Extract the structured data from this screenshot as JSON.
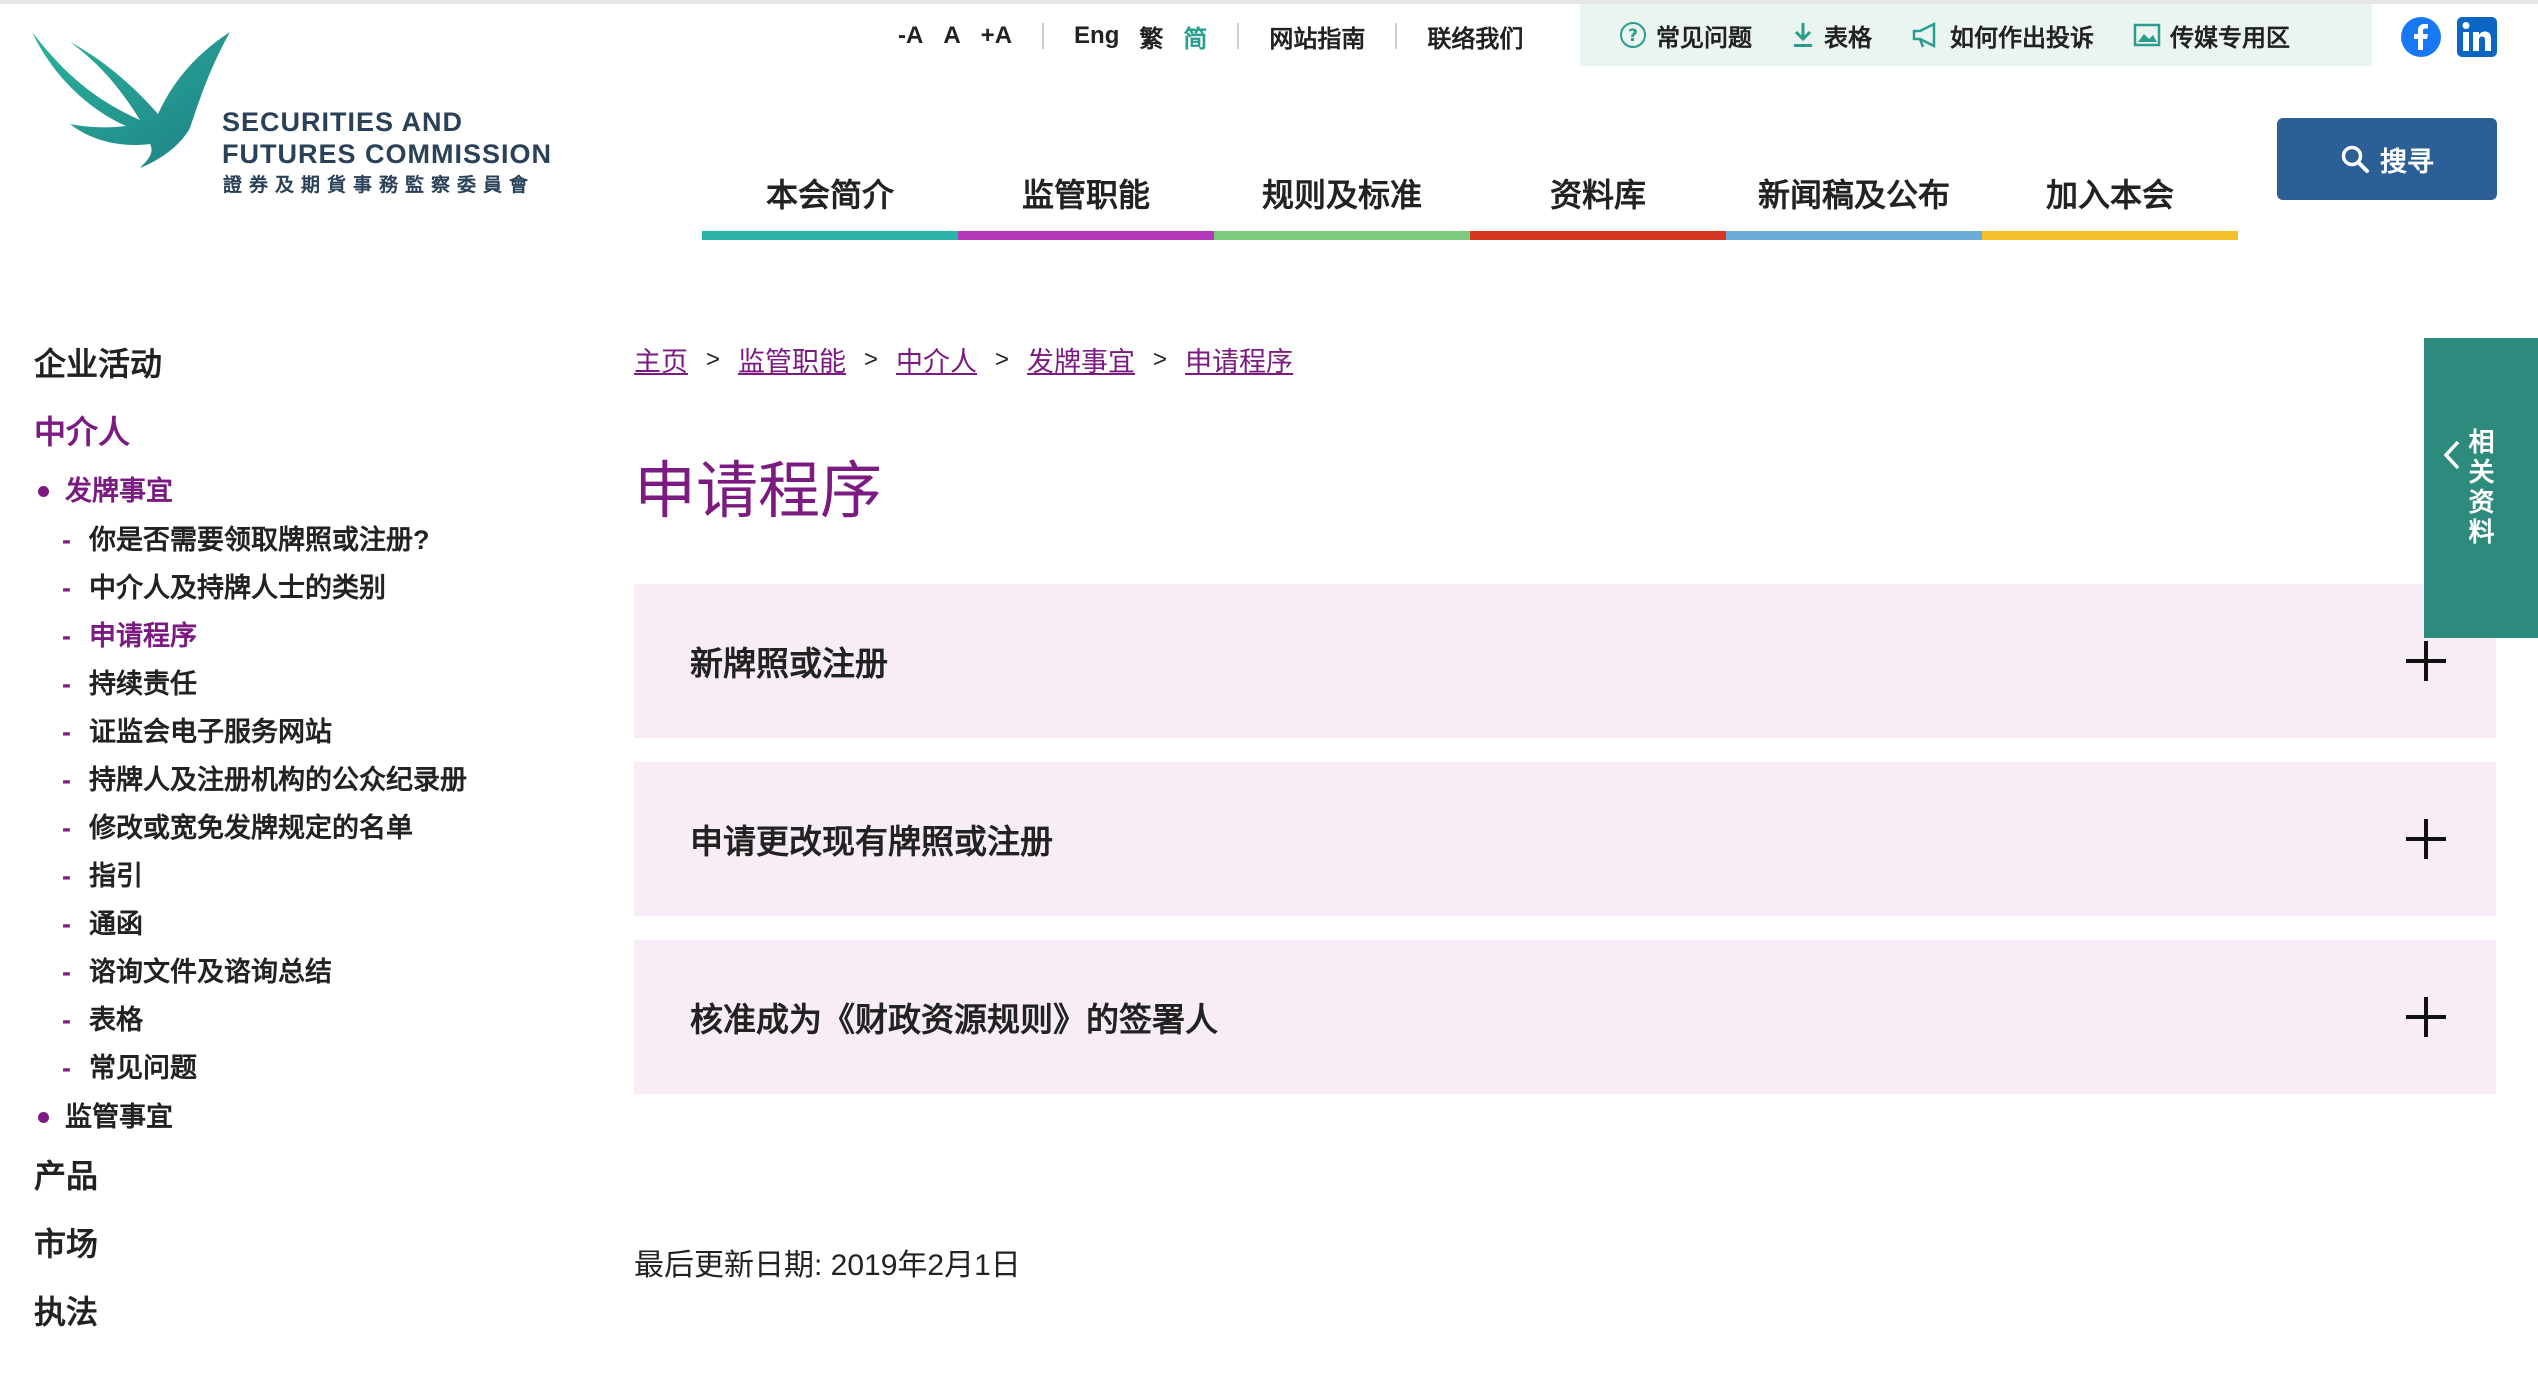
{
  "logo": {
    "en_line1": "SECURITIES AND",
    "en_line2": "FUTURES COMMISSION",
    "zh": "證券及期貨事務監察委員會"
  },
  "utility": {
    "font_small": "-A",
    "font_normal": "A",
    "font_large": "+A",
    "lang_en": "Eng",
    "lang_tc": "繁",
    "lang_sc": "简",
    "site_guide": "网站指南",
    "contact": "联络我们"
  },
  "quicklinks": [
    {
      "label": "常见问题",
      "icon": "help-circle-icon"
    },
    {
      "label": "表格",
      "icon": "download-icon"
    },
    {
      "label": "如何作出投诉",
      "icon": "megaphone-icon"
    },
    {
      "label": "传媒专用区",
      "icon": "image-icon"
    }
  ],
  "social": {
    "facebook": "facebook-icon",
    "linkedin": "linkedin-icon"
  },
  "search": {
    "label": "搜寻"
  },
  "mainnav": [
    {
      "label": "本会简介",
      "color": "#2ab3a6"
    },
    {
      "label": "监管职能",
      "color": "#b339b8"
    },
    {
      "label": "规则及标准",
      "color": "#7dc97e"
    },
    {
      "label": "资料库",
      "color": "#d5361f"
    },
    {
      "label": "新闻稿及公布",
      "color": "#6aabd8"
    },
    {
      "label": "加入本会",
      "color": "#f6bf2c"
    }
  ],
  "sidebar": {
    "top1": "企业活动",
    "top2": "中介人",
    "sub1": "发牌事宜",
    "leaves": [
      "你是否需要领取牌照或注册?",
      "中介人及持牌人士的类别",
      "申请程序",
      "持续责任",
      "证监会电子服务网站",
      "持牌人及注册机构的公众纪录册",
      "修改或宽免发牌规定的名单",
      "指引",
      "通函",
      "谘询文件及谘询总结",
      "表格",
      "常见问题"
    ],
    "sub2": "监管事宜",
    "top3": "产品",
    "top4": "市场",
    "top5": "执法"
  },
  "breadcrumb": [
    "主页",
    "监管职能",
    "中介人",
    "发牌事宜",
    "申请程序"
  ],
  "page_title": "申请程序",
  "accordion": [
    "新牌照或注册",
    "申请更改现有牌照或注册",
    "核准成为《财政资源规则》的签署人"
  ],
  "last_updated": "最后更新日期: 2019年2月1日",
  "sidetab": {
    "label": "相关资料"
  },
  "colors": {
    "brand_purple": "#7b1a80",
    "brand_teal": "#2a9d8f",
    "search_blue": "#2b5f96"
  }
}
